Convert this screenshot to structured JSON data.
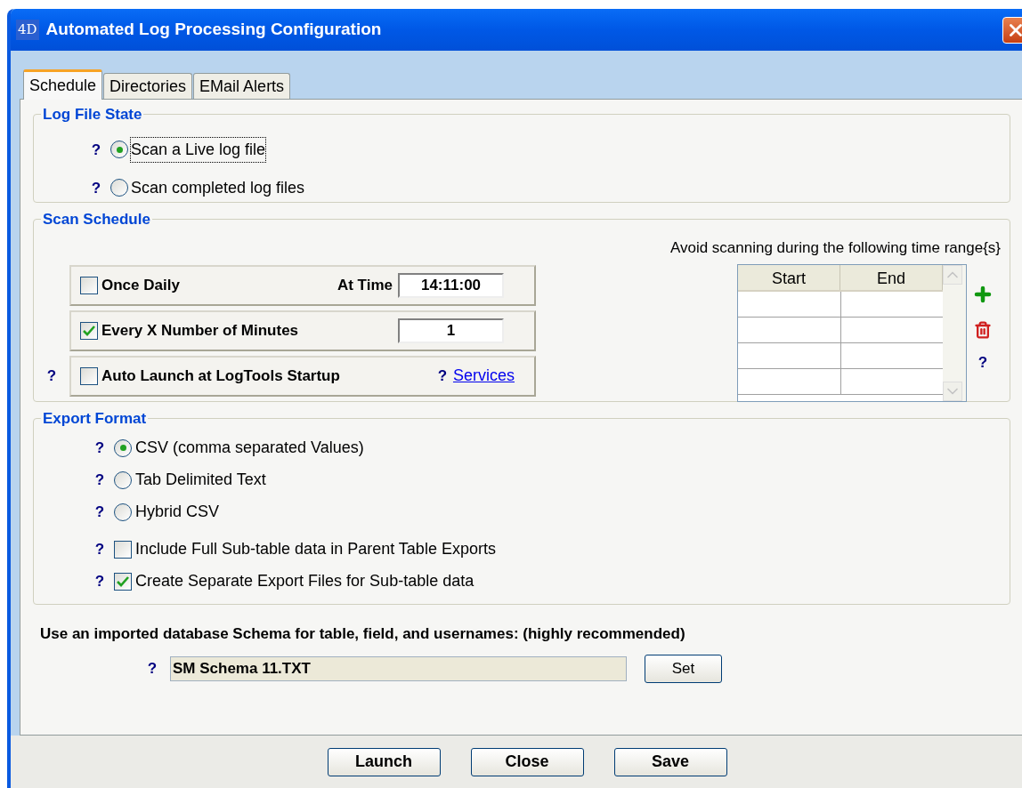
{
  "window": {
    "logo": "4D",
    "title": "Automated Log Processing Configuration"
  },
  "tabs": [
    {
      "label": "Schedule",
      "selected": true
    },
    {
      "label": "Directories",
      "selected": false
    },
    {
      "label": "EMail Alerts",
      "selected": false
    }
  ],
  "log_file_state": {
    "title": "Log File State",
    "options": [
      {
        "help": "?",
        "label": "Scan a Live log file",
        "selected": true,
        "focused": true
      },
      {
        "help": "?",
        "label": "Scan completed log files",
        "selected": false,
        "focused": false
      }
    ]
  },
  "scan_schedule": {
    "title": "Scan Schedule",
    "rows": [
      {
        "kind": "time",
        "label": "Once Daily",
        "checked": false,
        "field_label": "At Time",
        "value": "14:11:00"
      },
      {
        "kind": "number",
        "label": "Every X Number of Minutes",
        "checked": true,
        "value": "1"
      },
      {
        "kind": "link",
        "help": "?",
        "label": "Auto Launch at LogTools Startup",
        "checked": false,
        "link_help": "?",
        "link": "Services"
      }
    ],
    "avoid": {
      "caption": "Avoid scanning during the following time range{s}",
      "columns": [
        "Start",
        "End"
      ],
      "help": "?"
    }
  },
  "export_format": {
    "title": "Export Format",
    "options": [
      {
        "kind": "radio",
        "help": "?",
        "label": "CSV (comma separated Values)",
        "selected": true
      },
      {
        "kind": "radio",
        "help": "?",
        "label": "Tab Delimited Text",
        "selected": false
      },
      {
        "kind": "radio",
        "help": "?",
        "label": "Hybrid CSV",
        "selected": false
      },
      {
        "kind": "checkbox",
        "help": "?",
        "label": "Include Full Sub-table data in Parent Table Exports",
        "checked": false
      },
      {
        "kind": "checkbox",
        "help": "?",
        "label": "Create Separate Export Files for Sub-table data",
        "checked": true
      }
    ]
  },
  "schema": {
    "caption": "Use an imported database Schema for table, field, and usernames: (highly recommended)",
    "help": "?",
    "value": "SM Schema 11.TXT",
    "button": "Set"
  },
  "buttons": [
    "Launch",
    "Close",
    "Save"
  ]
}
